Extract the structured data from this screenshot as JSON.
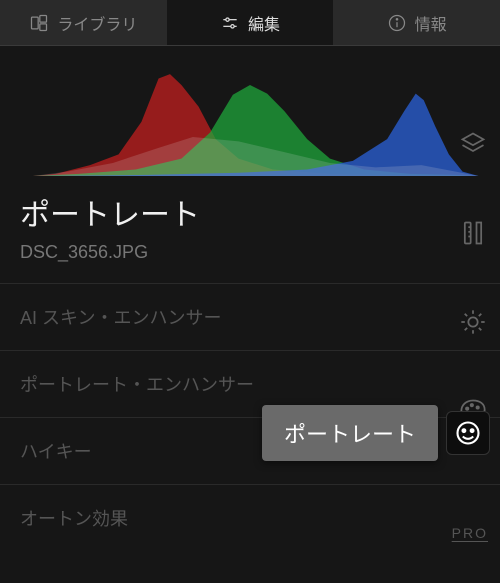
{
  "tabs": {
    "library": "ライブラリ",
    "edit": "編集",
    "info": "情報"
  },
  "section": {
    "title": "ポートレート",
    "filename": "DSC_3656.JPG"
  },
  "tools": [
    "AI スキン・エンハンサー",
    "ポートレート・エンハンサー",
    "ハイキー",
    "オートン効果"
  ],
  "tooltip": {
    "label": "ポートレート"
  },
  "rail": {
    "layers": "layers-icon",
    "ruler": "ruler-icon",
    "brightness": "brightness-icon",
    "palette": "palette-icon",
    "face": "face-icon"
  },
  "pro_label": "PRO"
}
